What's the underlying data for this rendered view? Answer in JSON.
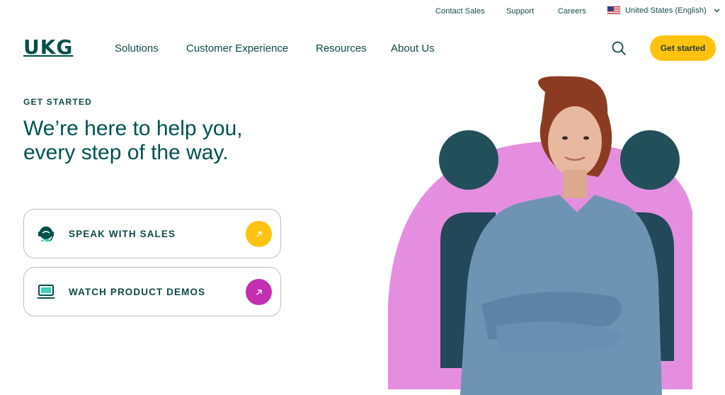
{
  "utility_nav": {
    "contact_sales": "Contact Sales",
    "support": "Support",
    "careers": "Careers",
    "region": "United States (English)"
  },
  "header": {
    "logo": "UKG",
    "nav": [
      "Solutions",
      "Customer Experience",
      "Resources",
      "About Us"
    ],
    "cta": "Get started"
  },
  "hero": {
    "eyebrow": "GET STARTED",
    "headline_line1": "We’re here to help you,",
    "headline_line2": "every step of the way.",
    "cards": [
      {
        "label": "SPEAK WITH SALES",
        "icon": "headset-icon",
        "arrow_color": "#ffc20e"
      },
      {
        "label": "WATCH PRODUCT DEMOS",
        "icon": "laptop-icon",
        "arrow_color": "#c22fb2"
      }
    ]
  },
  "colors": {
    "brand_teal": "#00504b",
    "accent_yellow": "#ffc20e",
    "accent_magenta": "#c22fb2",
    "accent_pink": "#e58ee0",
    "dark_teal_shape": "#22505a"
  }
}
